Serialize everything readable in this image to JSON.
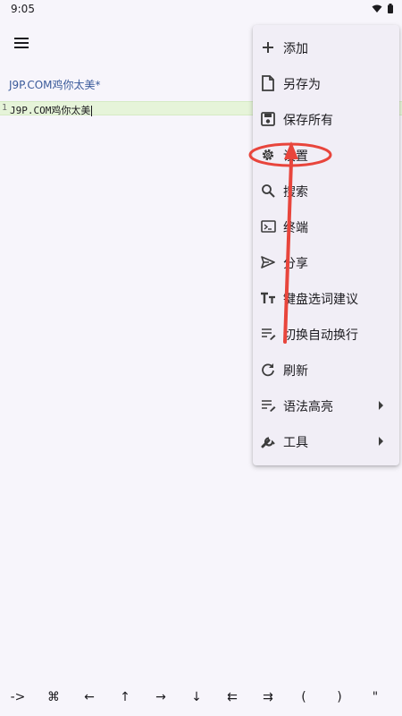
{
  "status_bar": {
    "time": "9:05"
  },
  "app_bar": {
    "menu_icon": "hamburger-menu-icon"
  },
  "tab": {
    "title": "J9P.COM鸡你太美*"
  },
  "editor": {
    "line_number": "1",
    "line_text": "J9P.COM鸡你太美"
  },
  "menu": {
    "items": [
      {
        "label": "添加",
        "icon": "plus-icon",
        "has_submenu": false
      },
      {
        "label": "另存为",
        "icon": "file-icon",
        "has_submenu": false
      },
      {
        "label": "保存所有",
        "icon": "save-icon",
        "has_submenu": false
      },
      {
        "label": "设置",
        "icon": "gear-icon",
        "has_submenu": false
      },
      {
        "label": "搜索",
        "icon": "search-icon",
        "has_submenu": false
      },
      {
        "label": "终端",
        "icon": "terminal-icon",
        "has_submenu": false
      },
      {
        "label": "分享",
        "icon": "send-icon",
        "has_submenu": false
      },
      {
        "label": "键盘选词建议",
        "icon": "text-size-icon",
        "has_submenu": false
      },
      {
        "label": "切换自动换行",
        "icon": "wrap-text-icon",
        "has_submenu": false
      },
      {
        "label": "刷新",
        "icon": "refresh-icon",
        "has_submenu": false
      },
      {
        "label": "语法高亮",
        "icon": "syntax-icon",
        "has_submenu": true
      },
      {
        "label": "工具",
        "icon": "wrench-icon",
        "has_submenu": true
      }
    ]
  },
  "annotation": {
    "color": "#e8453c"
  },
  "key_bar": {
    "keys": [
      "->",
      "⌘",
      "←",
      "↑",
      "→",
      "↓",
      "⇇",
      "⇉",
      "(",
      ")",
      "\""
    ]
  }
}
